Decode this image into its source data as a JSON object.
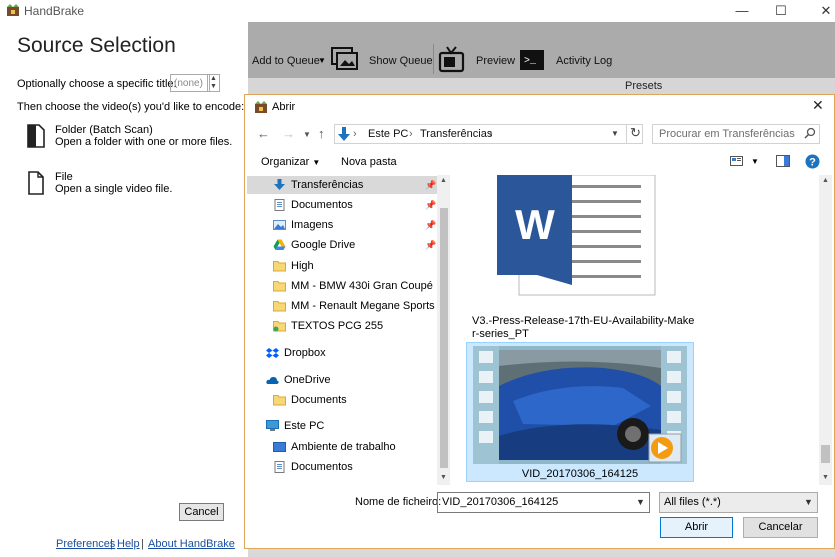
{
  "window": {
    "app_title": "HandBrake",
    "minimize": "—",
    "maximize": "☐",
    "close": "✕"
  },
  "source": {
    "heading": "Source Selection",
    "title_label": "Optionally choose a specific title:",
    "title_value": "(none)",
    "choose_label": "Then choose the video(s) you'd like to encode:",
    "folder_title": "Folder (Batch Scan)",
    "folder_desc": "Open a folder with one or more files.",
    "file_title": "File",
    "file_desc": "Open a single video file.",
    "cancel": "Cancel",
    "links": [
      "Preferences",
      "Help",
      "About HandBrake"
    ],
    "link_sep": "|"
  },
  "toolbar": {
    "add_to_queue": "Add to Queue",
    "show_queue": "Show Queue",
    "preview": "Preview",
    "activity_log": "Activity Log",
    "presets": "Presets"
  },
  "dialog": {
    "title": "Abrir",
    "breadcrumb": [
      "Este PC",
      "Transferências"
    ],
    "crumb_sep": "›",
    "search_placeholder": "Procurar em Transferências",
    "organize": "Organizar",
    "new_folder": "Nova pasta",
    "nav_items": [
      {
        "label": "Transferências",
        "icon": "download-arrow-icon",
        "pinned": true
      },
      {
        "label": "Documentos",
        "icon": "documents-icon",
        "pinned": true
      },
      {
        "label": "Imagens",
        "icon": "pictures-icon",
        "pinned": true
      },
      {
        "label": "Google Drive",
        "icon": "google-drive-icon",
        "pinned": true
      },
      {
        "label": "High",
        "icon": "folder-icon",
        "pinned": false
      },
      {
        "label": "MM - BMW 430i Gran Coupé",
        "icon": "folder-icon",
        "pinned": false
      },
      {
        "label": "MM - Renault Megane Sports Tou",
        "icon": "folder-icon",
        "pinned": false
      },
      {
        "label": "TEXTOS PCG 255",
        "icon": "folder-green-icon",
        "pinned": false
      },
      {
        "label": "Dropbox",
        "icon": "dropbox-icon",
        "pinned": false
      },
      {
        "label": "OneDrive",
        "icon": "onedrive-icon",
        "pinned": false
      },
      {
        "label": "Documents",
        "icon": "folder-icon",
        "pinned": false
      },
      {
        "label": "Este PC",
        "icon": "computer-icon",
        "pinned": false
      },
      {
        "label": "Ambiente de trabalho",
        "icon": "desktop-icon",
        "pinned": false
      },
      {
        "label": "Documentos",
        "icon": "documents-icon",
        "pinned": false
      }
    ],
    "files": [
      {
        "name": "V3.-Press-Release-17th-EU-Availability-Maker-series_PT",
        "icon": "word-document-icon"
      },
      {
        "name": "VID_20170306_164125",
        "icon": "video-thumbnail-icon"
      }
    ],
    "filename_label": "Nome de ficheiro:",
    "filename_value": "VID_20170306_164125",
    "filetype_value": "All files (*.*)",
    "open": "Abrir",
    "cancel": "Cancelar"
  },
  "colors": {
    "accent": "#0078d7",
    "selection": "#cce8ff",
    "word_blue": "#2b579a",
    "link": "#1a4fa0"
  }
}
